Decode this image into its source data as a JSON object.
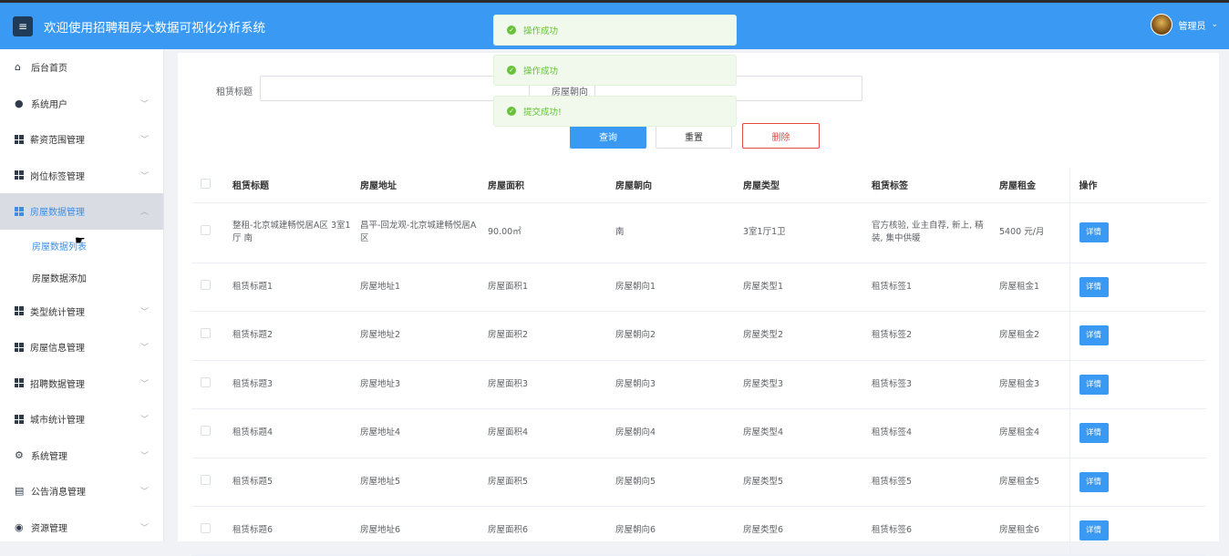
{
  "header": {
    "title": "欢迎使用招聘租房大数据可视化分析系统",
    "menu_icon": "≡",
    "user_label": "管理员",
    "user_chevron": "⌄"
  },
  "sidebar": {
    "items": [
      {
        "label": "后台首页",
        "icon": "home-icon"
      },
      {
        "label": "系统用户",
        "icon": "user-icon"
      },
      {
        "label": "薪资范围管理",
        "icon": "grid-icon"
      },
      {
        "label": "岗位标签管理",
        "icon": "grid-icon"
      },
      {
        "label": "房屋数据管理",
        "icon": "grid-icon"
      },
      {
        "label": "类型统计管理",
        "icon": "grid-icon"
      },
      {
        "label": "房屋信息管理",
        "icon": "grid-icon"
      },
      {
        "label": "招聘数据管理",
        "icon": "grid-icon"
      },
      {
        "label": "城市统计管理",
        "icon": "grid-icon"
      },
      {
        "label": "系统管理",
        "icon": "gear-icon"
      },
      {
        "label": "公告消息管理",
        "icon": "doc-icon"
      },
      {
        "label": "资源管理",
        "icon": "circle-icon"
      }
    ],
    "sub_items": [
      "房屋数据列表",
      "房屋数据添加"
    ]
  },
  "search": {
    "title_label": "租赁标题",
    "orientation_label": "房屋朝向",
    "query_button": "查询",
    "reset_button": "重置",
    "delete_button": "删除"
  },
  "toasts": [
    "操作成功",
    "操作成功",
    "提交成功!"
  ],
  "table": {
    "headers": [
      "租赁标题",
      "房屋地址",
      "房屋面积",
      "房屋朝向",
      "房屋类型",
      "租赁标签",
      "房屋租金",
      "操作"
    ],
    "detail_label": "详情",
    "rows": [
      [
        "整租-北京城建畅悦居A区 3室1厅 南",
        "昌平-回龙观-北京城建畅悦居A区",
        "90.00㎡",
        "南",
        "3室1厅1卫",
        "官方核验, 业主自荐, 新上, 精装, 集中供暖",
        "5400 元/月"
      ],
      [
        "租赁标题1",
        "房屋地址1",
        "房屋面积1",
        "房屋朝向1",
        "房屋类型1",
        "租赁标签1",
        "房屋租金1"
      ],
      [
        "租赁标题2",
        "房屋地址2",
        "房屋面积2",
        "房屋朝向2",
        "房屋类型2",
        "租赁标签2",
        "房屋租金2"
      ],
      [
        "租赁标题3",
        "房屋地址3",
        "房屋面积3",
        "房屋朝向3",
        "房屋类型3",
        "租赁标签3",
        "房屋租金3"
      ],
      [
        "租赁标题4",
        "房屋地址4",
        "房屋面积4",
        "房屋朝向4",
        "房屋类型4",
        "租赁标签4",
        "房屋租金4"
      ],
      [
        "租赁标题5",
        "房屋地址5",
        "房屋面积5",
        "房屋朝向5",
        "房屋类型5",
        "租赁标签5",
        "房屋租金5"
      ],
      [
        "租赁标题6",
        "房屋地址6",
        "房屋面积6",
        "房屋朝向6",
        "房屋类型6",
        "租赁标签6",
        "房屋租金6"
      ]
    ]
  },
  "colors": {
    "topbar": "#3a9af3",
    "accent": "#3a8ee6",
    "danger": "#e2493f",
    "success": "#67c23a"
  }
}
